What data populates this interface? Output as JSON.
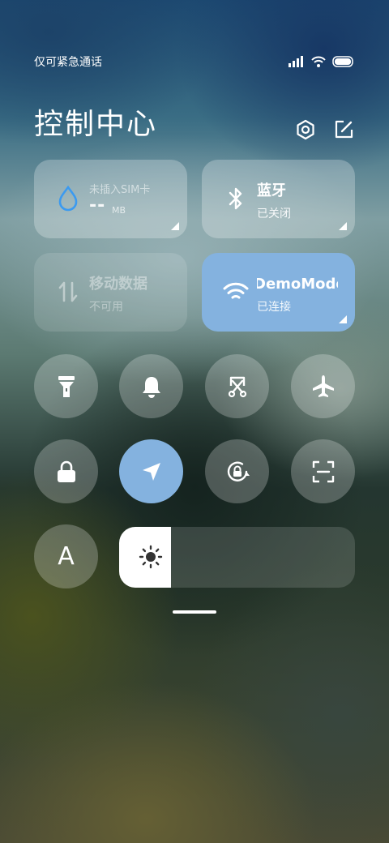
{
  "status_bar": {
    "carrier": "仅可紧急通话",
    "icons": [
      "signal-icon",
      "wifi-icon",
      "battery-icon"
    ]
  },
  "header": {
    "title": "控制中心",
    "icons": [
      "settings-icon",
      "edit-icon"
    ]
  },
  "tiles": {
    "data": {
      "label": "未插入SIM卡",
      "value": "--",
      "unit": "MB",
      "icon": "water-drop-icon"
    },
    "bluetooth": {
      "label": "蓝牙",
      "status": "已关闭",
      "icon": "bluetooth-icon"
    },
    "mobile_data": {
      "label": "移动数据",
      "status": "不可用",
      "icon": "data-arrows-icon"
    },
    "wifi": {
      "label": "DemoMode",
      "status": "已连接",
      "icon": "wifi-icon"
    }
  },
  "toggles_row1": [
    {
      "name": "flashlight-icon",
      "active": false
    },
    {
      "name": "bell-icon",
      "active": false
    },
    {
      "name": "screenshot-icon",
      "active": false
    },
    {
      "name": "airplane-icon",
      "active": false
    }
  ],
  "toggles_row2": [
    {
      "name": "lock-icon",
      "active": false
    },
    {
      "name": "location-icon",
      "active": true
    },
    {
      "name": "rotation-lock-icon",
      "active": false
    },
    {
      "name": "scan-icon",
      "active": false
    }
  ],
  "font_toggle": {
    "label": "A"
  },
  "brightness": {
    "level": 0.22,
    "icon": "sun-icon"
  },
  "colors": {
    "accent": "#84b2df",
    "tile": "rgba(255,255,255,0.26)"
  }
}
